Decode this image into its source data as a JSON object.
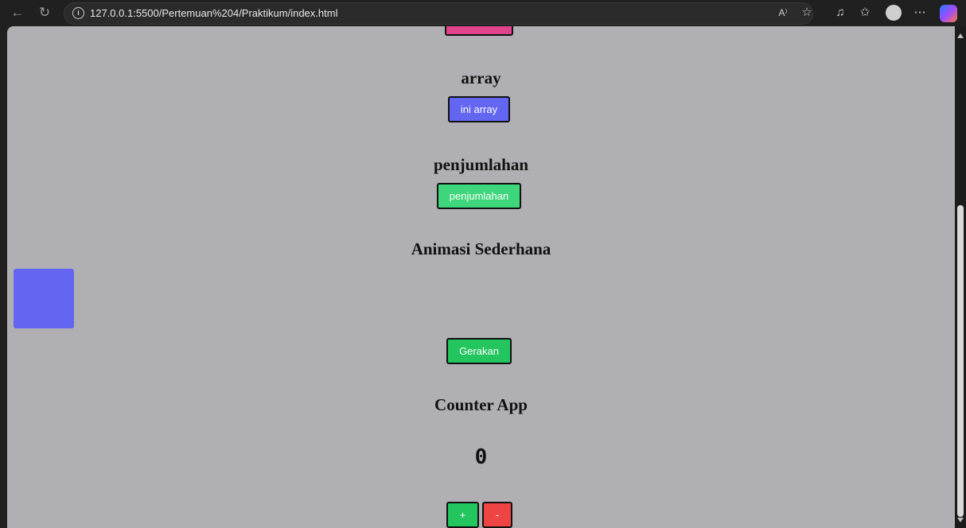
{
  "browser": {
    "url": "127.0.0.1:5500/Pertemuan%204/Praktikum/index.html",
    "icons": [
      "back-arrow-icon",
      "refresh-icon",
      "info-icon",
      "read-aloud-icon",
      "favorite-star-icon",
      "extensions-icon",
      "favorites-icon",
      "profile-avatar-icon",
      "more-options-icon",
      "copilot-icon"
    ]
  },
  "page": {
    "array_heading": "array",
    "array_button": "ini array",
    "sum_heading": "penjumlahan",
    "sum_button": "penjumlahan",
    "animation_heading": "Animasi Sederhana",
    "animation_button": "Gerakan",
    "counter_heading": "Counter App",
    "counter_value": "0",
    "plus_button": "+",
    "minus_button": "-"
  },
  "colors": {
    "page_background": "#b0afb4",
    "pink_button": "#e0438a",
    "array_button": "#6366f1",
    "sum_button": "#3ed67a",
    "green_button": "#22c55e",
    "red_button": "#ef4444",
    "animated_box": "#6466f1"
  }
}
